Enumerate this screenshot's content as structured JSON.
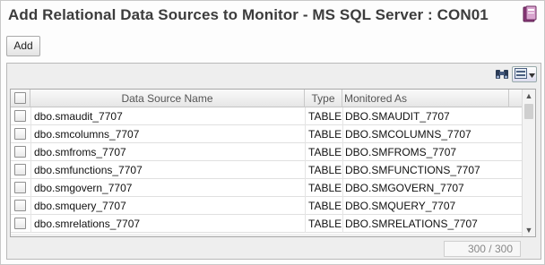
{
  "window": {
    "title": "Add Relational Data Sources to Monitor - MS SQL Server : CON01"
  },
  "toolbar": {
    "add_label": "Add"
  },
  "icons": {
    "help": "help-book-icon",
    "search": "binoculars-icon",
    "view": "view-options-icon",
    "dropdown": "chevron-down-icon"
  },
  "table": {
    "columns": [
      "Data Source Name",
      "Type",
      "Monitored As"
    ],
    "rows": [
      {
        "name": "dbo.smaudit_7707",
        "type": "TABLE",
        "monitored_as": "DBO.SMAUDIT_7707"
      },
      {
        "name": "dbo.smcolumns_7707",
        "type": "TABLE",
        "monitored_as": "DBO.SMCOLUMNS_7707"
      },
      {
        "name": "dbo.smfroms_7707",
        "type": "TABLE",
        "monitored_as": "DBO.SMFROMS_7707"
      },
      {
        "name": "dbo.smfunctions_7707",
        "type": "TABLE",
        "monitored_as": "DBO.SMFUNCTIONS_7707"
      },
      {
        "name": "dbo.smgovern_7707",
        "type": "TABLE",
        "monitored_as": "DBO.SMGOVERN_7707"
      },
      {
        "name": "dbo.smquery_7707",
        "type": "TABLE",
        "monitored_as": "DBO.SMQUERY_7707"
      },
      {
        "name": "dbo.smrelations_7707",
        "type": "TABLE",
        "monitored_as": "DBO.SMRELATIONS_7707"
      }
    ]
  },
  "status": {
    "count": "300 / 300"
  },
  "colors": {
    "title": "#3c3c3c",
    "panel_bg": "#eeeeee",
    "grid_border": "#a9a9a9"
  }
}
